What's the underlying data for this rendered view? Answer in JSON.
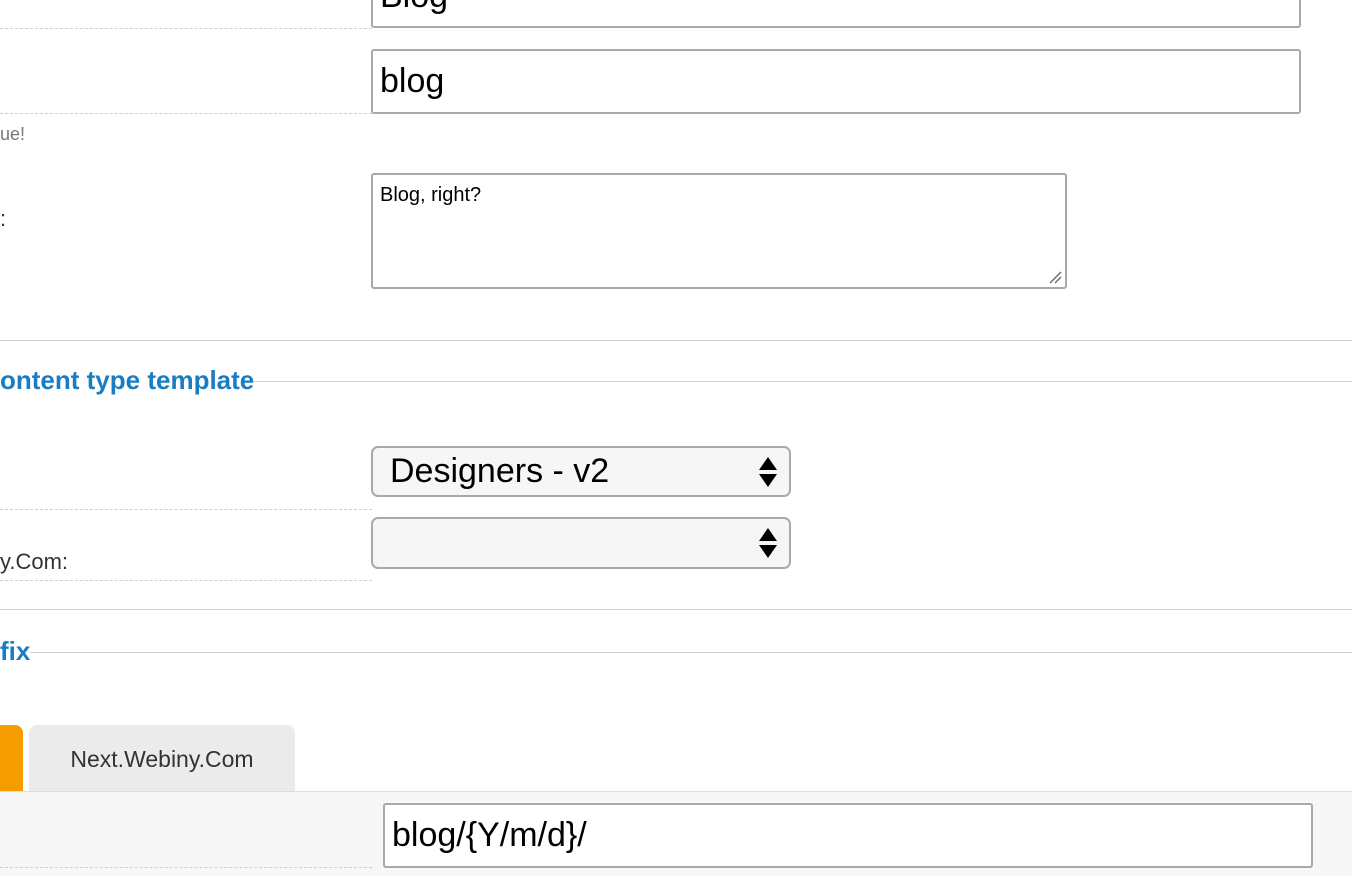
{
  "fields": {
    "title_value": "Blog",
    "slug_value": "blog",
    "slug_help": "ue!",
    "description_label": ":",
    "description_value": "Blog, right?"
  },
  "template_section": {
    "legend": "ontent type template",
    "template_select_value": "Designers - v2",
    "site_label": "y.Com:",
    "site_select_value": ""
  },
  "prefix_section": {
    "legend": "fix",
    "tabs": [
      {
        "label": "",
        "active": true
      },
      {
        "label": "Next.Webiny.Com",
        "active": false
      }
    ],
    "prefix_value": "blog/{Y/m/d}/"
  },
  "colors": {
    "accent_blue": "#1a7dc4",
    "active_tab_orange": "#f59c00",
    "inactive_tab_gray": "#ebebeb"
  }
}
